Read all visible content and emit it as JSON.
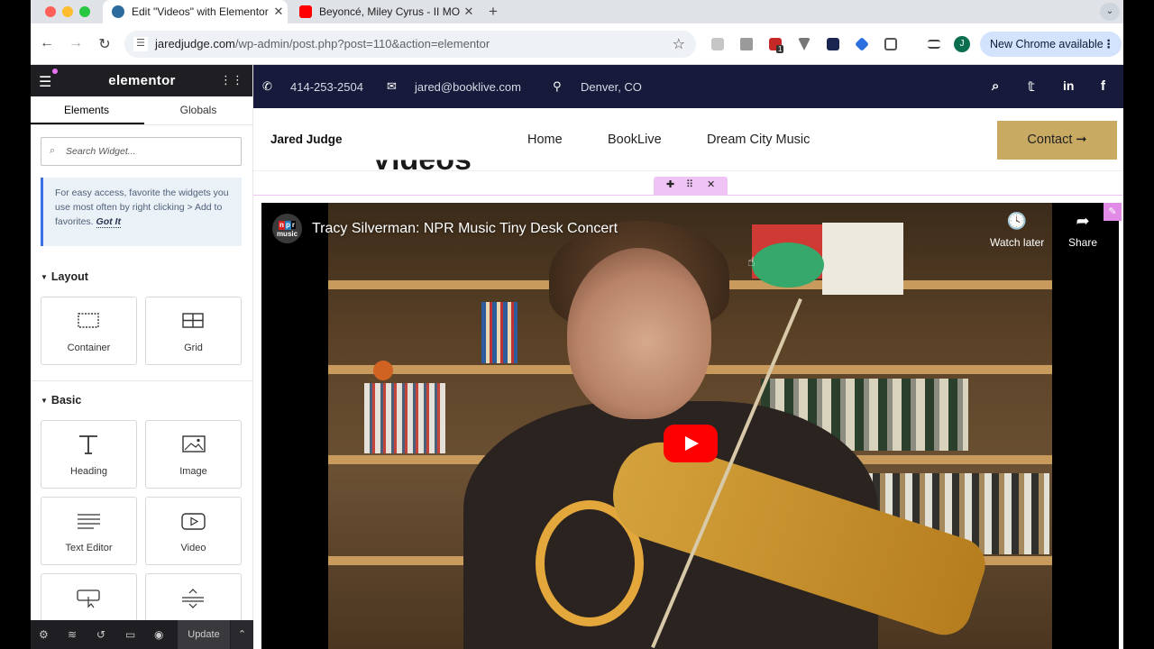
{
  "browser": {
    "tabs": [
      {
        "title": "Edit \"Videos\" with Elementor",
        "active": true
      },
      {
        "title": "Beyoncé, Miley Cyrus - II MOST WANTED",
        "active": false
      }
    ],
    "url_host": "jaredjudge.com",
    "url_path": "/wp-admin/post.php?post=110&action=elementor",
    "profile_initial": "J",
    "update_label": "New Chrome available",
    "extension_badge": "1"
  },
  "panel": {
    "logo": "elementor",
    "tabs": [
      "Elements",
      "Globals"
    ],
    "search_placeholder": "Search Widget...",
    "tip_text": "For easy access, favorite the widgets you use most often by right clicking > Add to favorites.",
    "tip_link": "Got It",
    "sections": {
      "layout": "Layout",
      "basic": "Basic"
    },
    "layout_widgets": [
      "Container",
      "Grid"
    ],
    "basic_widgets": [
      "Heading",
      "Image",
      "Text Editor",
      "Video",
      "",
      ""
    ],
    "footer_update": "Update"
  },
  "site": {
    "phone": "414-253-2504",
    "email": "jared@booklive.com",
    "location": "Denver, CO",
    "brand": "Jared Judge",
    "nav": [
      "Home",
      "BookLive",
      "Dream City Music"
    ],
    "contact_label": "Contact",
    "partial_heading": "Videos"
  },
  "video": {
    "title": "Tracy Silverman: NPR Music Tiny Desk Concert",
    "watch_later": "Watch later",
    "share": "Share",
    "channel_logo": "npr music"
  },
  "colors": {
    "topbar": "#171a3a",
    "contact_button": "#c9aa63",
    "elementor_accent": "#f0c3f5",
    "youtube_red": "#ff0000"
  }
}
